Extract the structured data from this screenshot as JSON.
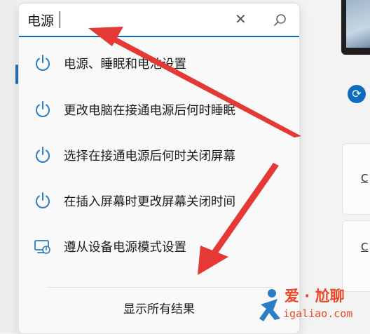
{
  "search": {
    "query": "电源"
  },
  "results": [
    {
      "icon": "power-icon",
      "label": "电源、睡眠和电池设置"
    },
    {
      "icon": "power-icon",
      "label": "更改电脑在接通电源后何时睡眠"
    },
    {
      "icon": "power-icon",
      "label": "选择在接通电源后何时关闭屏幕"
    },
    {
      "icon": "power-icon",
      "label": "在插入屏幕时更改屏幕关闭时间"
    },
    {
      "icon": "device-power-mode-icon",
      "label": "遵从设备电源模式设置"
    }
  ],
  "footer": {
    "show_all_label": "显示所有结果"
  },
  "background": {
    "card_1_letter": "C",
    "card_2_letter": "C"
  },
  "watermark": {
    "line1": "爱 · 尬聊",
    "line2": "igaliao.com"
  },
  "colors": {
    "accent": "#0f6cbd",
    "annotation_arrow": "#e53935",
    "watermark": "#e8492b"
  }
}
